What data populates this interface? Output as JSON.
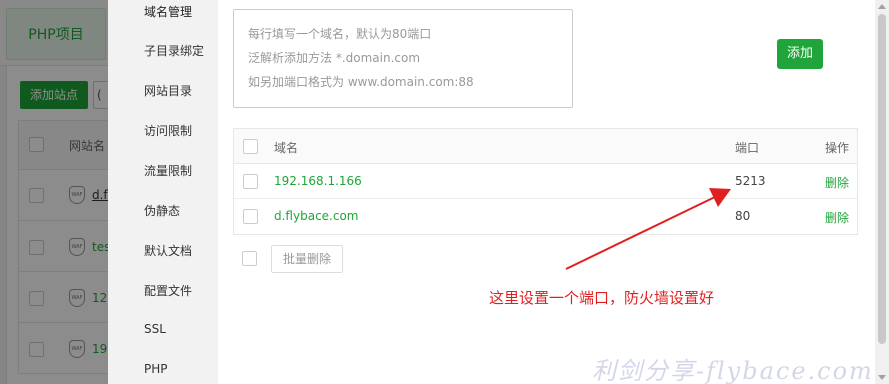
{
  "background": {
    "tab_label": "PHP项目",
    "add_site_label": "添加站点",
    "second_button_partial": "(",
    "column_site_name": "网站名",
    "rows": [
      {
        "name_partial": "d.fl",
        "waf": "WAF"
      },
      {
        "name_partial": "tes",
        "waf": "WAF"
      },
      {
        "name_partial": "12",
        "waf": "WAF"
      },
      {
        "name_partial": "19",
        "waf": "WAF"
      }
    ]
  },
  "modal": {
    "nav": [
      "域名管理",
      "子目录绑定",
      "网站目录",
      "访问限制",
      "流量限制",
      "伪静态",
      "默认文档",
      "配置文件",
      "SSL",
      "PHP"
    ],
    "domain_input": {
      "placeholder_lines": [
        "每行填写一个域名，默认为80端口",
        "泛解析添加方法 *.domain.com",
        "如另加端口格式为 www.domain.com:88"
      ]
    },
    "add_button": "添加",
    "table": {
      "headers": {
        "domain": "域名",
        "port": "端口",
        "action": "操作"
      },
      "rows": [
        {
          "domain": "192.168.1.166",
          "port": "5213",
          "action": "删除"
        },
        {
          "domain": "d.flybace.com",
          "port": "80",
          "action": "删除"
        }
      ]
    },
    "batch_delete_button": "批量删除"
  },
  "annotation": {
    "text": "这里设置一个端口，防火墙设置好",
    "color": "#e02020"
  },
  "watermark": "利剑分享-flybace.com",
  "colors": {
    "accent": "#20a53a",
    "annotation": "#e02020"
  }
}
